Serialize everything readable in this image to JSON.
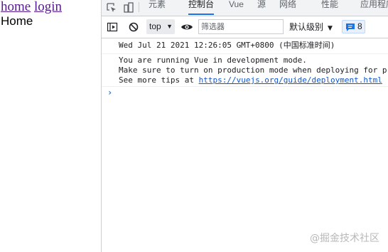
{
  "page": {
    "nav": {
      "home": "home",
      "login": "login"
    },
    "heading": "Home"
  },
  "devtools": {
    "tabs": [
      {
        "label": "元素",
        "active": false
      },
      {
        "label": "控制台",
        "active": true
      },
      {
        "label": "Vue",
        "active": false
      },
      {
        "label": "源",
        "active": false
      },
      {
        "label": "网络",
        "active": false
      },
      {
        "label": "性能",
        "active": false
      },
      {
        "label": "应用程序",
        "active": false
      }
    ],
    "toolbar": {
      "context": "top",
      "filter_placeholder": "筛选器",
      "levels": "默认级别",
      "issues_count": "8"
    },
    "console": {
      "timestamp": "Wed Jul 21 2021 12:26:05 GMT+0800 (中国标准时间)",
      "line1": "You are running Vue in development mode.",
      "line2": "Make sure to turn on production mode when deploying for production.",
      "line3_prefix": "See more tips at ",
      "link": "https://vuejs.org/guide/deployment.html"
    }
  },
  "watermark": "@掘金技术社区",
  "colors": {
    "accent": "#1a73e8",
    "link_visited": "#551a8b",
    "console_link": "#1155cc"
  }
}
